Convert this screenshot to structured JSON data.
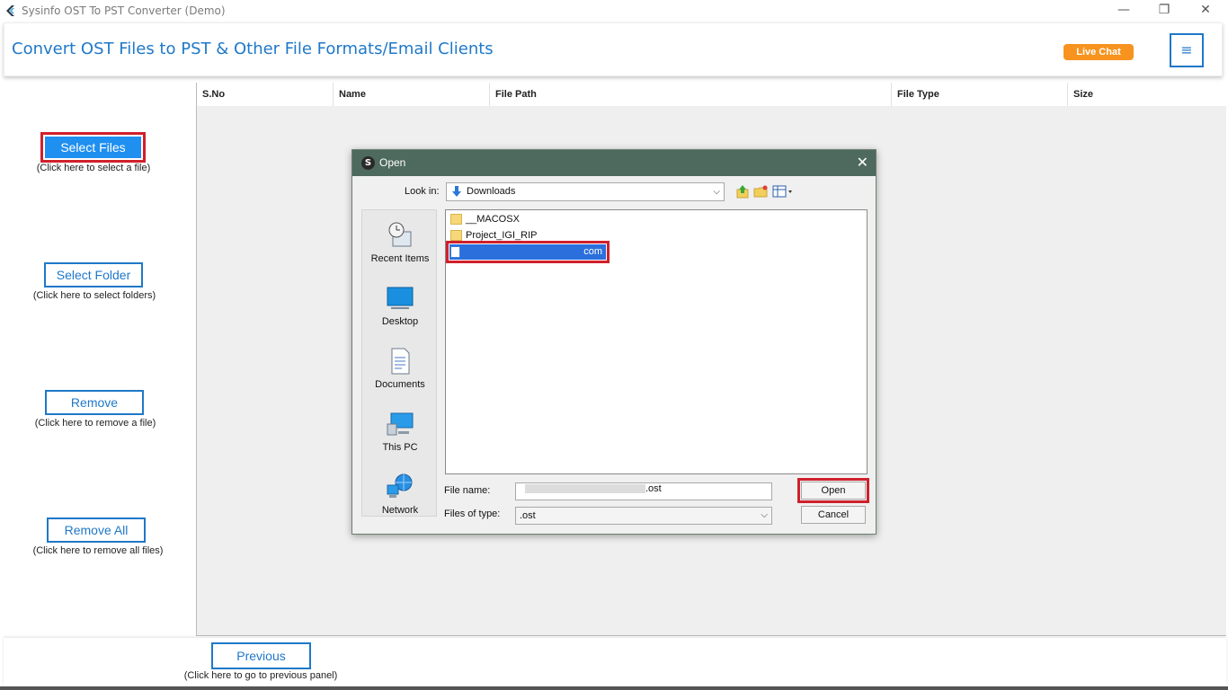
{
  "window": {
    "title": "Sysinfo OST To PST Converter (Demo)",
    "minimize": "—",
    "restore": "❐",
    "close": "✕"
  },
  "header": {
    "heading": "Convert OST Files to PST & Other File Formats/Email Clients",
    "live_chat": "Live Chat",
    "menu_icon": "≡"
  },
  "sidebar": {
    "select_files": {
      "label": "Select Files",
      "hint": "(Click here to select a file)"
    },
    "select_folder": {
      "label": "Select Folder",
      "hint": "(Click here to select folders)"
    },
    "remove": {
      "label": "Remove",
      "hint": "(Click here to remove a file)"
    },
    "remove_all": {
      "label": "Remove All",
      "hint": "(Click here to remove all files)"
    }
  },
  "table": {
    "columns": [
      "S.No",
      "Name",
      "File Path",
      "File Type",
      "Size"
    ]
  },
  "footer": {
    "previous": "Previous",
    "previous_hint": "(Click here to go to previous panel)"
  },
  "dialog": {
    "title": "Open",
    "icon_letter": "S",
    "close": "✕",
    "look_in_label": "Look in:",
    "look_in_value": "Downloads",
    "places": [
      "Recent Items",
      "Desktop",
      "Documents",
      "This PC",
      "Network"
    ],
    "files": [
      "__MACOSX",
      "Project_IGI_RIP"
    ],
    "selected_file_suffix": "com",
    "file_name_label": "File name:",
    "file_name_value": ".ost",
    "files_of_type_label": "Files of type:",
    "files_of_type_value": ".ost",
    "open_button": "Open",
    "cancel_button": "Cancel"
  }
}
